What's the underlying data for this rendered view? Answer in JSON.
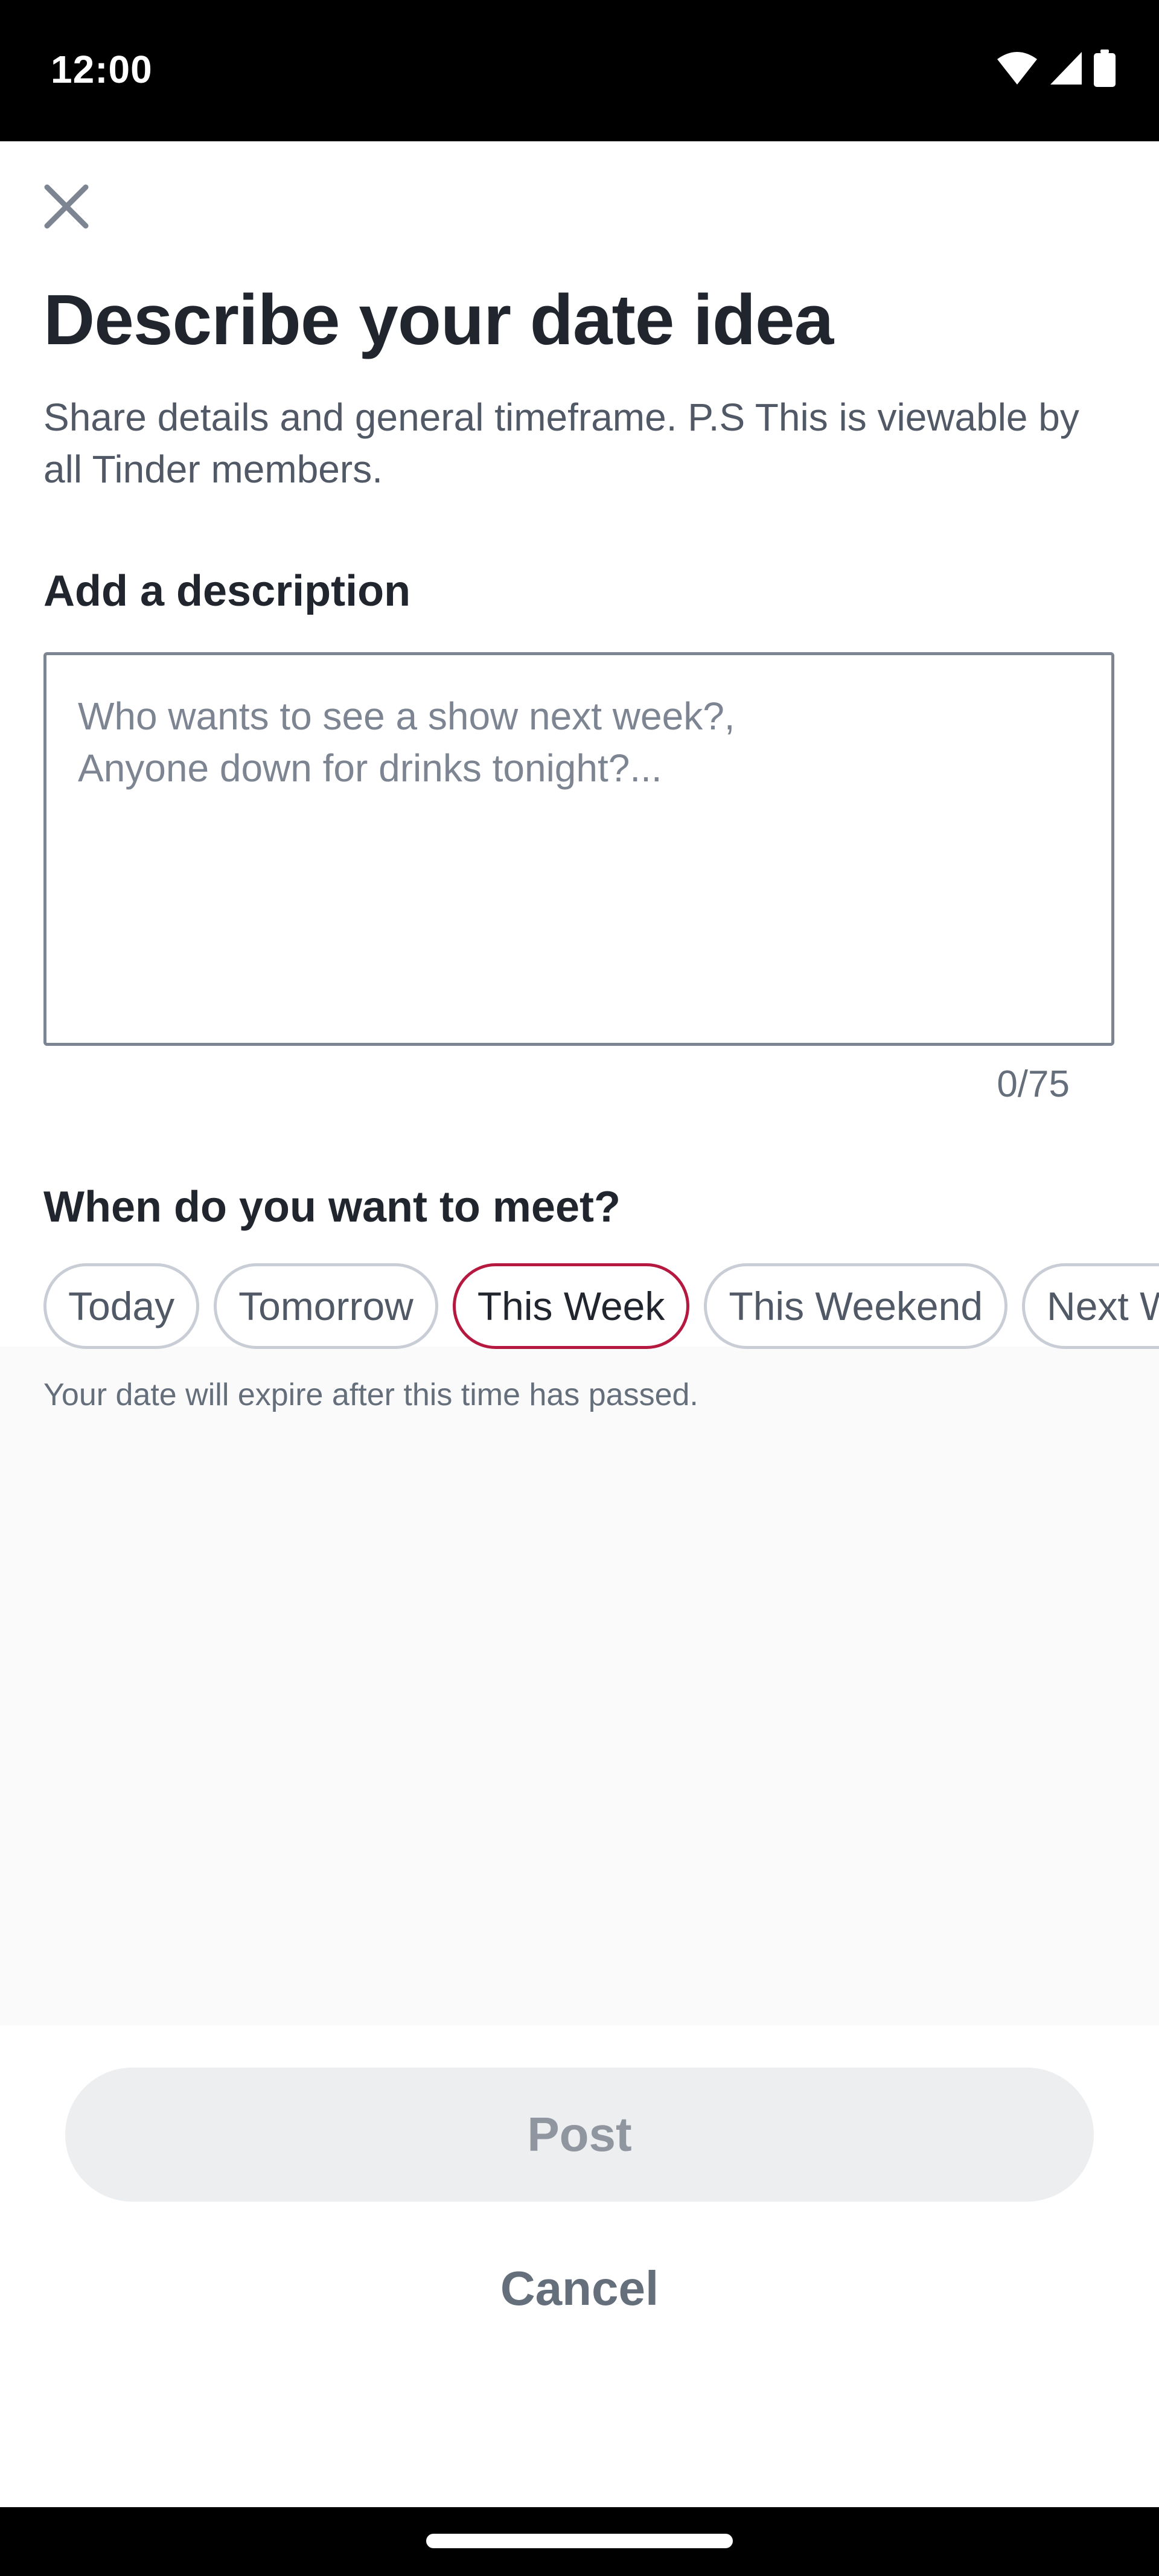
{
  "status_bar": {
    "time": "12:00",
    "icons": [
      "wifi-icon",
      "signal-icon",
      "battery-icon"
    ]
  },
  "header": {
    "close_icon": "close-icon",
    "title": "Describe your date idea",
    "subtitle": "Share details and general timeframe. P.S This is viewable by all Tinder members."
  },
  "description": {
    "label": "Add a description",
    "value": "",
    "placeholder": "Who wants to see a show next week?,\nAnyone down for drinks tonight?...",
    "counter": "0/75"
  },
  "meet": {
    "label": "When do you want to meet?",
    "options": [
      "Today",
      "Tomorrow",
      "This Week",
      "This Weekend",
      "Next Week"
    ],
    "selected": "This Week",
    "helper": "Your date will expire after this time has passed."
  },
  "actions": {
    "post_label": "Post",
    "cancel_label": "Cancel"
  },
  "colors": {
    "accent": "#b5193f",
    "title_text": "#21262e",
    "secondary_text": "#505965",
    "post_disabled_bg": "#eceef0"
  }
}
